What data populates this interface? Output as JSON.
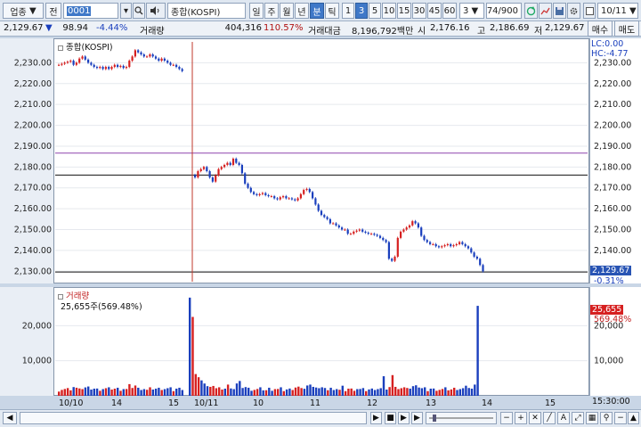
{
  "toolbar": {
    "market": "업종",
    "mode": "전",
    "code": "0001",
    "index_name": "종합(KOSPI)",
    "periods": [
      "일",
      "주",
      "월",
      "년",
      "분",
      "틱"
    ],
    "selected_period": "분",
    "minute_options": [
      "1",
      "3",
      "5",
      "10",
      "15",
      "30",
      "45",
      "60"
    ],
    "selected_minute": "3",
    "custom_interval": "3",
    "count": "174/900",
    "date": "10/11"
  },
  "info": {
    "price": "2,129.67",
    "change": "98.94",
    "change_pct": "-4.44%",
    "volume_label": "거래량",
    "volume": "404,316",
    "volume_ratio": "110.57%",
    "amount_label": "거래대금",
    "amount": "8,196,792백만",
    "open_label": "시",
    "open": "2,176.16",
    "high_label": "고",
    "high": "2,186.69",
    "low_label": "저",
    "low": "2,129.67"
  },
  "side_buttons": {
    "buy": "매수",
    "sell": "매도"
  },
  "price_panel": {
    "legend": "종합(KOSPI)",
    "lc": "LC:0.00",
    "hc": "HC:-4.77",
    "last_price": "2,129.67",
    "last_change": "-0.31%"
  },
  "volume_panel": {
    "legend": "거래량",
    "value_text": "25,655주(569.48%)",
    "last_volume": "25,655",
    "last_ratio": "569.48%"
  },
  "x_axis": {
    "labels": [
      "10/10",
      "14",
      "15",
      "10/11",
      "10",
      "11",
      "12",
      "13",
      "14",
      "15"
    ],
    "time_readout": "15:30:00"
  },
  "chart_data": {
    "type": "candlestick",
    "price_axis": {
      "ylim": [
        2125,
        2240
      ],
      "ticks": [
        "2,230.00",
        "2,220.00",
        "2,210.00",
        "2,200.00",
        "2,190.00",
        "2,180.00",
        "2,170.00",
        "2,160.00",
        "2,150.00",
        "2,140.00",
        "2,130.00"
      ]
    },
    "volume_axis": {
      "ylim": [
        0,
        30000
      ],
      "ticks": [
        "20,000",
        "10,000"
      ]
    },
    "reference_lines": [
      2186.69,
      2176.16,
      2129.67
    ],
    "day1_close": [
      2229,
      2229.5,
      2230,
      2230.5,
      2231,
      2229,
      2230,
      2232,
      2233,
      2231.5,
      2230,
      2229,
      2228,
      2227.5,
      2228,
      2227,
      2228,
      2227,
      2228,
      2229,
      2228,
      2228.5,
      2227.5,
      2228,
      2231,
      2233,
      2236,
      2235,
      2234,
      2233,
      2233,
      2234,
      2233,
      2232,
      2231,
      2232,
      2231,
      2230,
      2229,
      2229,
      2228,
      2227,
      2226
    ],
    "day2_close": [
      2175,
      2178,
      2179,
      2180,
      2178,
      2175,
      2173,
      2176,
      2179,
      2180,
      2181,
      2182,
      2181,
      2184,
      2182,
      2181,
      2177,
      2172,
      2170,
      2168,
      2167,
      2166.5,
      2167,
      2167.5,
      2166.5,
      2166,
      2166,
      2165,
      2164.5,
      2165.5,
      2166,
      2165,
      2165,
      2164.5,
      2164,
      2165,
      2167,
      2169,
      2169.5,
      2168,
      2165,
      2162,
      2159,
      2157,
      2156,
      2155,
      2153,
      2153,
      2152,
      2151,
      2150,
      2150,
      2148,
      2148,
      2149,
      2149.5,
      2150,
      2149,
      2148.5,
      2148,
      2148,
      2147.5,
      2147,
      2146,
      2145,
      2144,
      2136,
      2135,
      2137,
      2146,
      2149,
      2150,
      2151,
      2152,
      2154,
      2153,
      2151,
      2147,
      2145,
      2144,
      2143,
      2143,
      2142,
      2141.5,
      2142,
      2142.5,
      2143,
      2142,
      2142.5,
      2143,
      2144,
      2143,
      2142,
      2141,
      2139,
      2137,
      2136,
      2133,
      2130
    ]
  }
}
